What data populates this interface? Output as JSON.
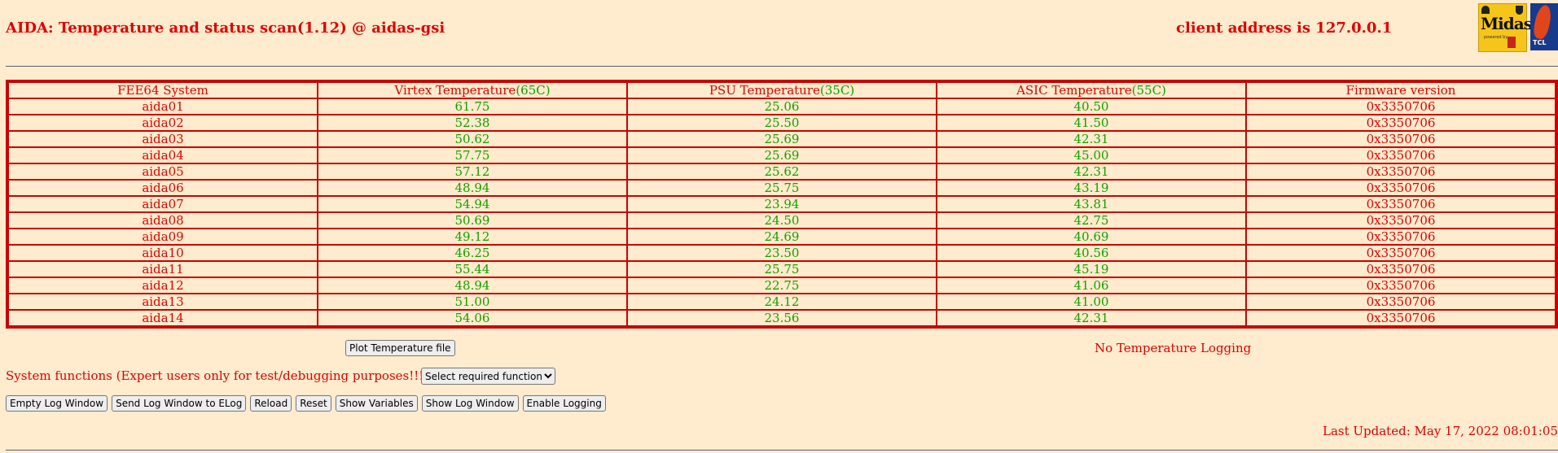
{
  "header": {
    "title": "AIDA: Temperature and status scan(1.12) @ aidas-gsi",
    "client": "client address is 127.0.0.1"
  },
  "logos": {
    "midas": "Midas",
    "midas_small": "powered by",
    "tcl": "TCL"
  },
  "table": {
    "columns": [
      {
        "label": "FEE64 System",
        "limit": ""
      },
      {
        "label": "Virtex Temperature",
        "limit": "(65C)"
      },
      {
        "label": "PSU Temperature",
        "limit": "(35C)"
      },
      {
        "label": "ASIC Temperature",
        "limit": "(55C)"
      },
      {
        "label": "Firmware version",
        "limit": ""
      }
    ],
    "rows": [
      {
        "system": "aida01",
        "virtex": "61.75",
        "psu": "25.06",
        "asic": "40.50",
        "firmware": "0x3350706"
      },
      {
        "system": "aida02",
        "virtex": "52.38",
        "psu": "25.50",
        "asic": "41.50",
        "firmware": "0x3350706"
      },
      {
        "system": "aida03",
        "virtex": "50.62",
        "psu": "25.69",
        "asic": "42.31",
        "firmware": "0x3350706"
      },
      {
        "system": "aida04",
        "virtex": "57.75",
        "psu": "25.69",
        "asic": "45.00",
        "firmware": "0x3350706"
      },
      {
        "system": "aida05",
        "virtex": "57.12",
        "psu": "25.62",
        "asic": "42.31",
        "firmware": "0x3350706"
      },
      {
        "system": "aida06",
        "virtex": "48.94",
        "psu": "25.75",
        "asic": "43.19",
        "firmware": "0x3350706"
      },
      {
        "system": "aida07",
        "virtex": "54.94",
        "psu": "23.94",
        "asic": "43.81",
        "firmware": "0x3350706"
      },
      {
        "system": "aida08",
        "virtex": "50.69",
        "psu": "24.50",
        "asic": "42.75",
        "firmware": "0x3350706"
      },
      {
        "system": "aida09",
        "virtex": "49.12",
        "psu": "24.69",
        "asic": "40.69",
        "firmware": "0x3350706"
      },
      {
        "system": "aida10",
        "virtex": "46.25",
        "psu": "23.50",
        "asic": "40.56",
        "firmware": "0x3350706"
      },
      {
        "system": "aida11",
        "virtex": "55.44",
        "psu": "25.75",
        "asic": "45.19",
        "firmware": "0x3350706"
      },
      {
        "system": "aida12",
        "virtex": "48.94",
        "psu": "22.75",
        "asic": "41.06",
        "firmware": "0x3350706"
      },
      {
        "system": "aida13",
        "virtex": "51.00",
        "psu": "24.12",
        "asic": "41.00",
        "firmware": "0x3350706"
      },
      {
        "system": "aida14",
        "virtex": "54.06",
        "psu": "23.56",
        "asic": "42.31",
        "firmware": "0x3350706"
      }
    ]
  },
  "plot_button": "Plot Temperature file",
  "logging_status": "No Temperature Logging",
  "system_functions": {
    "label": "System functions (Expert users only for test/debugging purposes!!!)",
    "select_value": "Select required function"
  },
  "buttons": [
    "Empty Log Window",
    "Send Log Window to ELog",
    "Reload",
    "Reset",
    "Show Variables",
    "Show Log Window",
    "Enable Logging"
  ],
  "last_updated": "Last Updated: May 17, 2022 08:01:05",
  "colors": {
    "background": "#ffebcd",
    "text_red": "#e00000",
    "value_green": "#14a000",
    "table_border": "#cc0000"
  }
}
